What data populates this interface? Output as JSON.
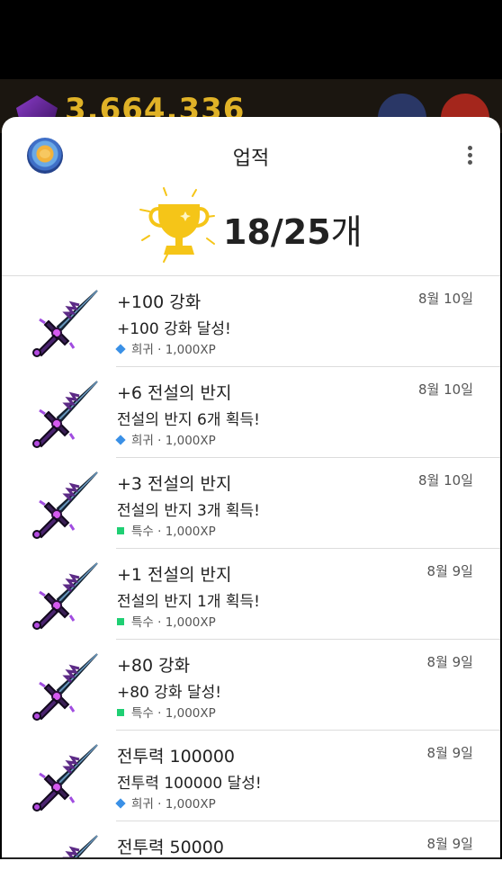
{
  "background": {
    "currency_value": "3,664,336",
    "colors": {
      "backdrop": "#000000",
      "currency": "#e0b227"
    }
  },
  "header": {
    "title": "업적",
    "achievement_count": "18/25",
    "count_suffix": "개"
  },
  "achievements": [
    {
      "title": "+100 강화",
      "date": "8월 10일",
      "description": "+100 강화 달성!",
      "rarity": "희귀",
      "xp": "1,000XP",
      "rarity_icon": "diamond-icon"
    },
    {
      "title": "+6 전설의 반지",
      "date": "8월 10일",
      "description": "전설의 반지 6개 획득!",
      "rarity": "희귀",
      "xp": "1,000XP",
      "rarity_icon": "diamond-icon"
    },
    {
      "title": "+3 전설의 반지",
      "date": "8월 10일",
      "description": "전설의 반지 3개 획득!",
      "rarity": "특수",
      "xp": "1,000XP",
      "rarity_icon": "square-icon"
    },
    {
      "title": "+1 전설의 반지",
      "date": "8월 9일",
      "description": "전설의 반지 1개 획득!",
      "rarity": "특수",
      "xp": "1,000XP",
      "rarity_icon": "square-icon"
    },
    {
      "title": "+80 강화",
      "date": "8월 9일",
      "description": "+80 강화 달성!",
      "rarity": "특수",
      "xp": "1,000XP",
      "rarity_icon": "square-icon"
    },
    {
      "title": "전투력 100000",
      "date": "8월 9일",
      "description": "전투력 100000 달성!",
      "rarity": "희귀",
      "xp": "1,000XP",
      "rarity_icon": "diamond-icon"
    },
    {
      "title": "전투력 50000",
      "date": "8월 9일",
      "description": "",
      "rarity": "",
      "xp": "",
      "rarity_icon": ""
    }
  ],
  "colors": {
    "rare": "#3a90e6",
    "special": "#1fcf73",
    "trophy": "#f5c518"
  }
}
